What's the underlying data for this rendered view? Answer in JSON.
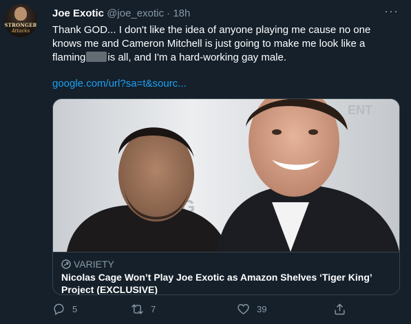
{
  "tweet": {
    "avatar": {
      "line1": "STRONGER",
      "line2": "Attacks"
    },
    "name": "Joe Exotic",
    "handle": "@joe_exotic",
    "separator": "·",
    "time": "18h",
    "more": "···",
    "text_part1": "Thank GOD... I don't like the idea of anyone playing me cause no one knows me and Cameron Mitchell is just going to make me look like a flaming",
    "text_part2": "is all, and I'm a hard-working gay male.",
    "link": "google.com/url?sa=t&sourc...",
    "card": {
      "source": "VARIETY",
      "title": "Nicolas Cage Won’t Play Joe Exotic as Amazon Shelves ‘Tiger King’ Project (EXCLUSIVE)"
    },
    "actions": {
      "replies": "5",
      "retweets": "7",
      "likes": "39"
    }
  },
  "colors": {
    "background": "#15202b",
    "secondary_text": "#8899a6",
    "link": "#1da1f2",
    "border": "#38444d"
  }
}
